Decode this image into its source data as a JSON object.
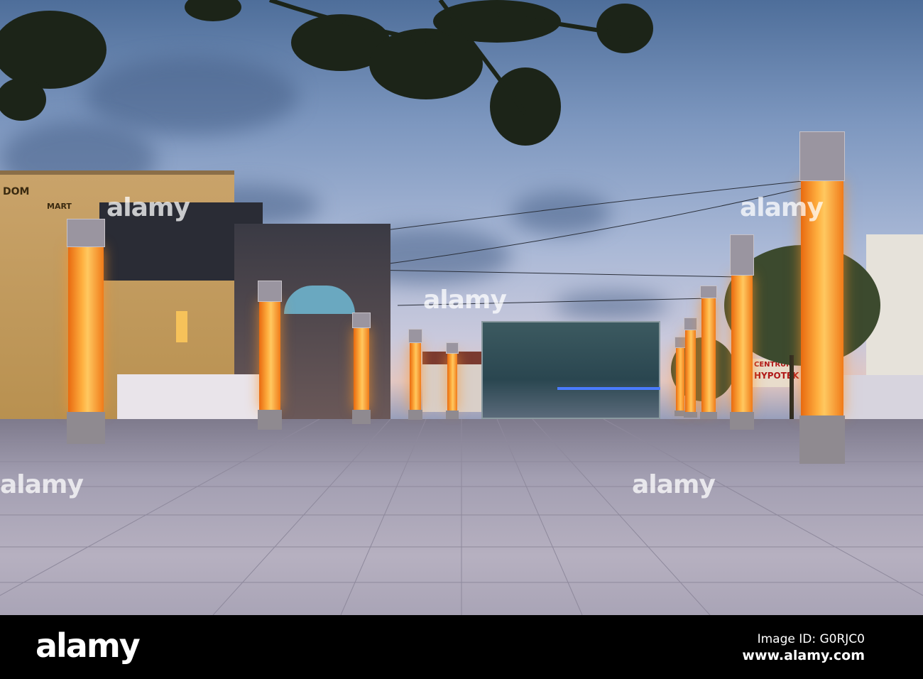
{
  "photo": {
    "subject": "Town square at dusk with illuminated orange light pillars",
    "signs": {
      "building_left_1": "DOM",
      "building_left_2": "MART",
      "shop_line1": "CENTRUM",
      "shop_line2": "HYPOTEK"
    },
    "colors": {
      "pillar": "#ff9a2a",
      "sky": "#8ea3c8",
      "pavement": "#a9a4b6"
    }
  },
  "watermark": {
    "text": "alamy"
  },
  "footer": {
    "logo": "alamy",
    "image_id": "Image ID: G0RJC0",
    "url": "www.alamy.com"
  }
}
